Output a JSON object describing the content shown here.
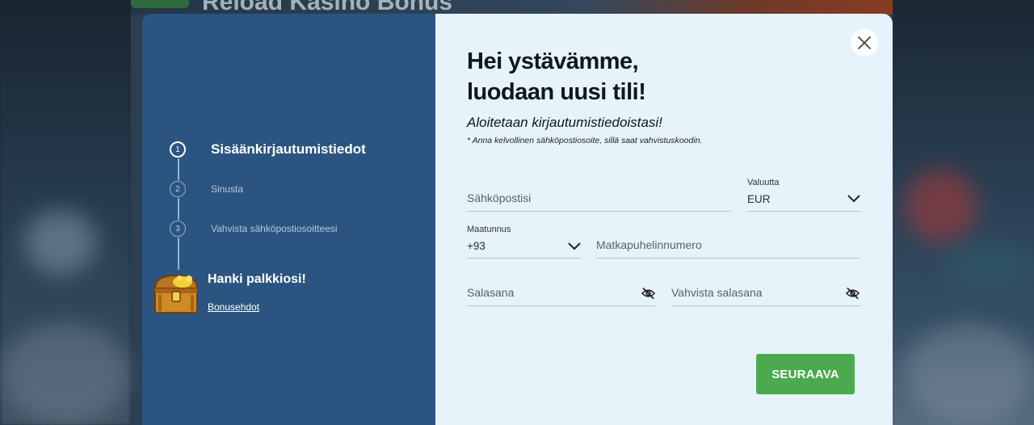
{
  "background": {
    "page_title": "Reload Kasino Bonus"
  },
  "modal": {
    "steps": [
      {
        "number": "1",
        "label": "Sisäänkirjautumistiedot",
        "active": true
      },
      {
        "number": "2",
        "label": "Sinusta",
        "active": false
      },
      {
        "number": "3",
        "label": "Vahvista sähköpostiosoitteesi",
        "active": false
      }
    ],
    "reward": {
      "title": "Hanki palkkiosi!",
      "link": "Bonusehdot",
      "icon": "treasure-chest-icon"
    },
    "heading_line1": "Hei ystävämme,",
    "heading_line2": "luodaan uusi tili!",
    "subheading": "Aloitetaan kirjautumistiedoistasi!",
    "note": "* Anna kelvollinen sähköpostiosoite, sillä saat vahvistuskoodin.",
    "fields": {
      "email": {
        "placeholder": "Sähköpostisi"
      },
      "currency": {
        "label": "Valuutta",
        "value": "EUR"
      },
      "country_code": {
        "label": "Maatunnus",
        "value": "+93"
      },
      "phone": {
        "placeholder": "Matkapuhelinnumero"
      },
      "password": {
        "placeholder": "Salasana"
      },
      "confirm_password": {
        "placeholder": "Vahvista salasana"
      }
    },
    "next_button": "SEURAAVA",
    "colors": {
      "left_panel": "#2b5580",
      "right_panel": "#e6f3fb",
      "button": "#4caa4e"
    }
  }
}
